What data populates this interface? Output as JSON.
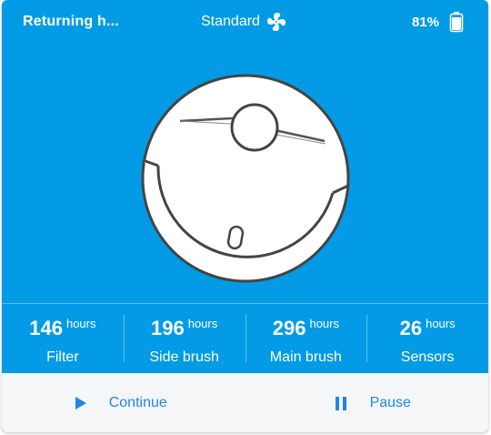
{
  "header": {
    "status": "Returning h...",
    "mode": "Standard",
    "mode_icon": "fan-icon",
    "battery": "81%",
    "battery_icon": "battery-icon"
  },
  "device": {
    "image": "robot-vacuum-illustration"
  },
  "stats": [
    {
      "value": "146",
      "unit": "hours",
      "label": "Filter"
    },
    {
      "value": "196",
      "unit": "hours",
      "label": "Side brush"
    },
    {
      "value": "296",
      "unit": "hours",
      "label": "Main brush"
    },
    {
      "value": "26",
      "unit": "hours",
      "label": "Sensors"
    }
  ],
  "actions": {
    "continue_label": "Continue",
    "continue_icon": "play-icon",
    "pause_label": "Pause",
    "pause_icon": "pause-icon"
  },
  "colors": {
    "card_background": "#039be5",
    "footer_background": "#f5f6f8",
    "action_text": "#1e88e5",
    "text_on_card": "#ffffff"
  }
}
